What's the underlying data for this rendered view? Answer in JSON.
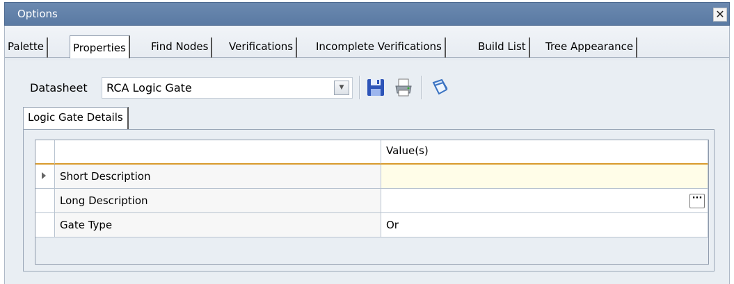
{
  "window": {
    "title": "Options",
    "close_glyph": "✕"
  },
  "tabs": [
    {
      "label": "Palette",
      "active": false
    },
    {
      "label": "Properties",
      "active": true
    },
    {
      "label": "Find Nodes",
      "active": false
    },
    {
      "label": "Verifications",
      "active": false
    },
    {
      "label": "Incomplete Verifications",
      "active": false
    },
    {
      "label": "Build List",
      "active": false
    },
    {
      "label": "Tree Appearance",
      "active": false
    }
  ],
  "datasheet": {
    "label": "Datasheet",
    "value": "RCA Logic Gate",
    "dropdown_glyph": "▼",
    "icons": [
      "save-icon",
      "print-icon",
      "datasheet-icon"
    ]
  },
  "inner_tab": {
    "label": "Logic Gate Details"
  },
  "grid": {
    "columns": [
      "",
      "Value(s)"
    ],
    "rows": [
      {
        "name": "Short Description",
        "value": "",
        "current": true
      },
      {
        "name": "Long Description",
        "value": "",
        "has_ellipsis": true
      },
      {
        "name": "Gate Type",
        "value": "Or"
      }
    ],
    "ellipsis_label": "···"
  },
  "colors": {
    "titlebar": "#5a7aa3",
    "header_underline": "#d89a2c",
    "panel_bg": "#e9eef3"
  }
}
